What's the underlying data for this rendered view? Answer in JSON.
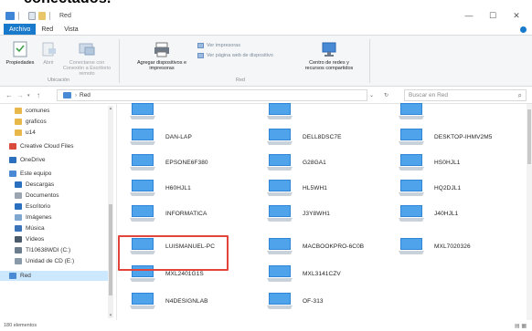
{
  "top_caption": "conectados.",
  "window": {
    "title": "Red",
    "minimize": "—",
    "maximize": "☐",
    "close": "✕"
  },
  "ribbon_tabs": [
    {
      "label": "Archivo"
    },
    {
      "label": "Red"
    },
    {
      "label": "Vista"
    }
  ],
  "ribbon": {
    "properties": "Propiedades",
    "open": "Abrir",
    "connect_remote": "Conectarse con Conexión a Escritorio remoto",
    "add_devices": "Agregar dispositivos e impresoras",
    "view_printers": "Ver impresoras",
    "view_device_page": "Ver página web de dispositivo",
    "network_center": "Centro de redes y recursos compartidos",
    "group_location": "Ubicación",
    "group_network": "Red"
  },
  "address": {
    "crumb": "Red",
    "refresh": "↻"
  },
  "search": {
    "placeholder": "Buscar en Red"
  },
  "nav_items": [
    {
      "label": "comunes",
      "icon": "folder-icon",
      "color": "#e8b84a"
    },
    {
      "label": "graficos",
      "icon": "folder-icon",
      "color": "#e8b84a"
    },
    {
      "label": "u14",
      "icon": "folder-icon",
      "color": "#e8b84a"
    },
    {
      "label": "Creative Cloud Files",
      "icon": "creative-cloud-icon",
      "color": "#d94b3c"
    },
    {
      "label": "OneDrive",
      "icon": "cloud-icon",
      "color": "#2b6fbf"
    },
    {
      "label": "Este equipo",
      "icon": "computer-icon",
      "color": "#4a8ad4"
    },
    {
      "label": "Descargas",
      "icon": "download-icon",
      "color": "#2b6fbf"
    },
    {
      "label": "Documentos",
      "icon": "documents-icon",
      "color": "#9aa5b1"
    },
    {
      "label": "Escritorio",
      "icon": "desktop-icon",
      "color": "#2b6fbf"
    },
    {
      "label": "Imágenes",
      "icon": "pictures-icon",
      "color": "#7fa7d0"
    },
    {
      "label": "Música",
      "icon": "music-icon",
      "color": "#3a73b8"
    },
    {
      "label": "Vídeos",
      "icon": "video-icon",
      "color": "#4a5a6a"
    },
    {
      "label": "TI10638WDI (C:)",
      "icon": "drive-icon",
      "color": "#6b7c8c"
    },
    {
      "label": "Unidad de CD (E:)",
      "icon": "cd-drive-icon",
      "color": "#8a9aa8"
    },
    {
      "label": "Red",
      "icon": "network-icon",
      "color": "#4a8ad4"
    }
  ],
  "network_items": [
    {
      "label": ""
    },
    {
      "label": ""
    },
    {
      "label": ""
    },
    {
      "label": "DAN-LAP"
    },
    {
      "label": "DELL8DSC7E"
    },
    {
      "label": "DESKTOP-IHMV2M5"
    },
    {
      "label": "EPSONE6F380"
    },
    {
      "label": "G28GA1"
    },
    {
      "label": "HS0HJL1"
    },
    {
      "label": "H60HJL1"
    },
    {
      "label": "HL5WH1"
    },
    {
      "label": "HQ2DJL1"
    },
    {
      "label": "INFORMATICA"
    },
    {
      "label": "J3Y8WH1"
    },
    {
      "label": "J40HJL1"
    },
    {
      "label": "LUISMANUEL-PC"
    },
    {
      "label": "MACBOOKPRO-6C0B"
    },
    {
      "label": "MXL7020326"
    },
    {
      "label": "MXL2401G1S"
    },
    {
      "label": "MXL3141CZV"
    },
    {
      "label": ""
    },
    {
      "label": "N4DESIGNLAB"
    },
    {
      "label": "OF-313"
    },
    {
      "label": ""
    }
  ],
  "status": {
    "count": "180 elementos"
  },
  "colors": {
    "accent": "#1979ca",
    "highlight": "#e2443b"
  }
}
